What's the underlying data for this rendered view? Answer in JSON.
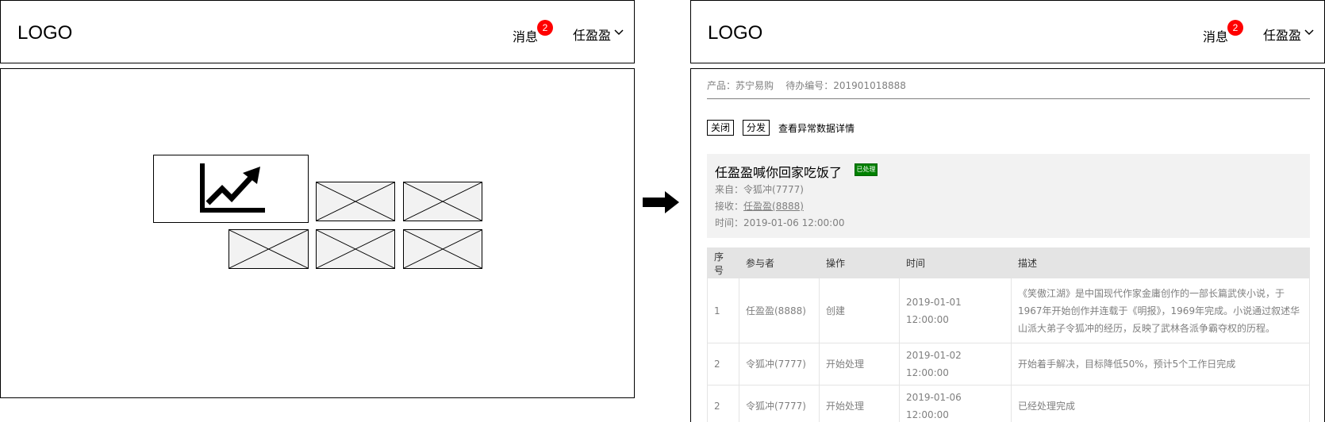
{
  "header": {
    "logo": "LOGO",
    "messages_label": "消息",
    "messages_count": "2",
    "user_name": "任盈盈"
  },
  "left_panel": {
    "chart_icon": "line-chart-icon",
    "image_placeholders": 5
  },
  "detail": {
    "meta": "产品：苏宁易购    待办编号：201901018888",
    "actions": {
      "close_label": "关闭",
      "dispatch_label": "分发",
      "view_anomaly_label": "查看异常数据详情"
    },
    "card": {
      "title": "任盈盈喊你回家吃饭了",
      "status": "已处理",
      "from_label": "来自：",
      "from_value": "令狐冲(7777)",
      "to_label": "接收：",
      "to_value": "任盈盈(8888)",
      "time_label": "时间：",
      "time_value": "2019-01-06 12:00:00"
    },
    "table": {
      "headers": [
        "序号",
        "参与者",
        "操作",
        "时间",
        "描述"
      ],
      "rows": [
        [
          "1",
          "任盈盈(8888)",
          "创建",
          "2019-01-01 12:00:00",
          "《笑傲江湖》是中国现代作家金庸创作的一部长篇武侠小说，于1967年开始创作并连载于《明报》，1969年完成。小说通过叙述华山派大弟子令狐冲的经历，反映了武林各派争霸夺权的历程。"
        ],
        [
          "2",
          "令狐冲(7777)",
          "开始处理",
          "2019-01-02 12:00:00",
          "开始着手解决，目标降低50%，预计5个工作日完成"
        ],
        [
          "2",
          "令狐冲(7777)",
          "开始处理",
          "2019-01-06 12:00:00",
          "已经处理完成"
        ]
      ]
    }
  },
  "colors": {
    "badge": "#ff0000",
    "status_badge": "#008000",
    "card_bg": "#f2f2f2",
    "table_header_bg": "#e4e4e4",
    "muted_text": "#7f7f7f"
  }
}
